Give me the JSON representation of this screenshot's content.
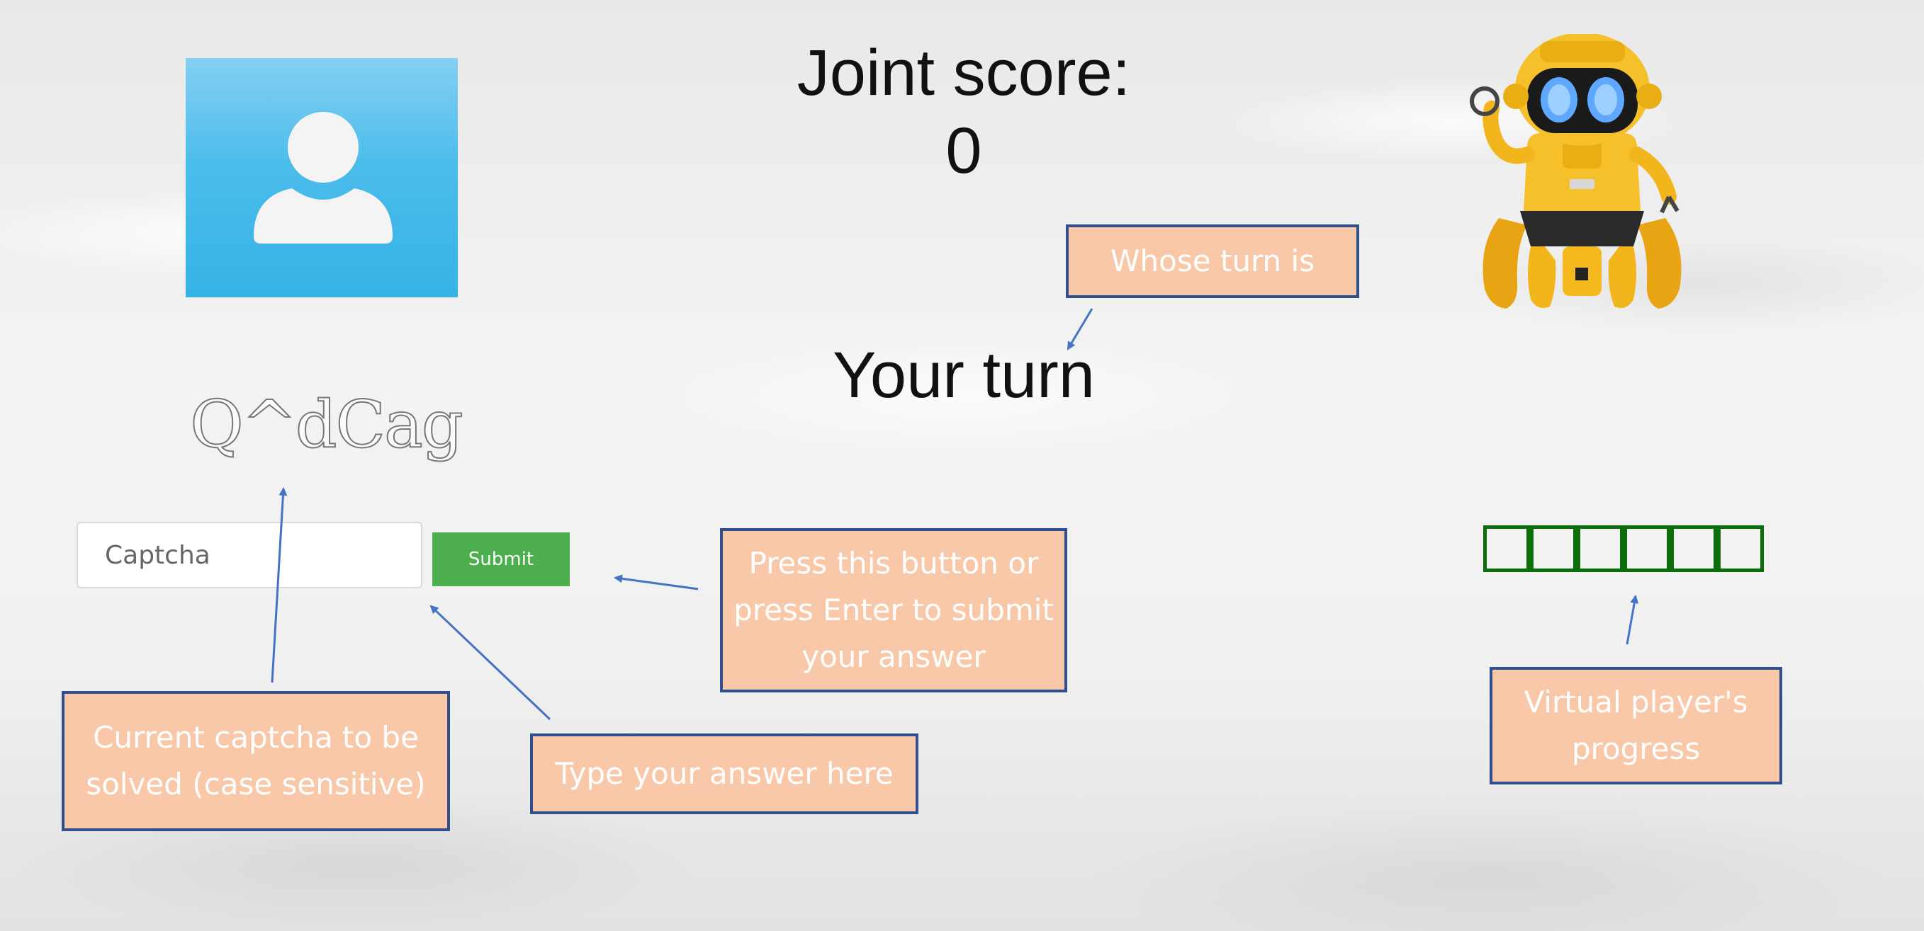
{
  "score": {
    "label": "Joint score:",
    "value": "0"
  },
  "turn": {
    "text": "Your turn"
  },
  "captcha": {
    "current": "Q^dCag",
    "input_placeholder": "Captcha",
    "input_value": "",
    "submit_label": "Submit"
  },
  "progress": {
    "total_boxes": 6,
    "filled": 0,
    "color": "#0b6e0b"
  },
  "callouts": {
    "whose_turn": "Whose turn is",
    "press_button": "Press this button or press Enter to submit your answer",
    "current_captcha": "Current captcha to be solved (case sensitive)",
    "type_answer": "Type your answer here",
    "virtual_progress": "Virtual player's progress"
  },
  "colors": {
    "callout_fill": "#f8c8a9",
    "callout_border": "#2f4f8f",
    "arrow": "#4472c4",
    "submit_bg": "#4cae4c",
    "avatar_bg": "#36b3e6"
  },
  "icons": {
    "avatar": "user-avatar-icon",
    "robot": "robot-player-icon"
  }
}
